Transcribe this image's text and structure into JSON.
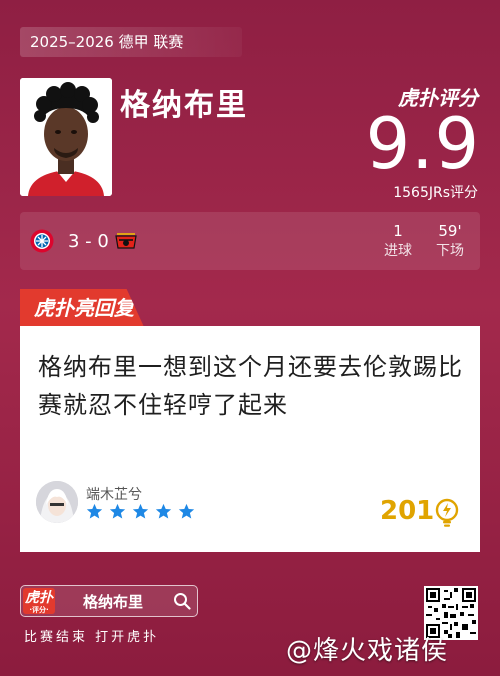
{
  "header": {
    "season": "2025–2026 德甲 联赛",
    "player_name": "格纳布里",
    "brand": "虎扑评分",
    "rating": "9.9",
    "rating_count": "1565JRs评分"
  },
  "match": {
    "score": "3 - 0",
    "home_team_icon": "bayern-logo",
    "away_team_icon": "leverkusen-logo",
    "stats": [
      {
        "value": "1",
        "label": "进球"
      },
      {
        "value": "59'",
        "label": "下场"
      }
    ]
  },
  "highlight": {
    "tag": "虎扑亮回复",
    "comment": "格纳布里一想到这个月还要去伦敦踢比赛就忍不住轻哼了起来",
    "username": "端木芷兮",
    "stars": 5,
    "likes": "201"
  },
  "footer": {
    "search_logo": "虎扑",
    "search_logo_sub": "·评分·",
    "search_query": "格纳布里",
    "caption": "比赛结束 打开虎扑",
    "watermark": "@烽火戏诸侯"
  },
  "colors": {
    "background": "#9a2447",
    "accent_red": "#e23a2e",
    "likes_gold": "#e0a400",
    "star_blue": "#1e88e5"
  }
}
